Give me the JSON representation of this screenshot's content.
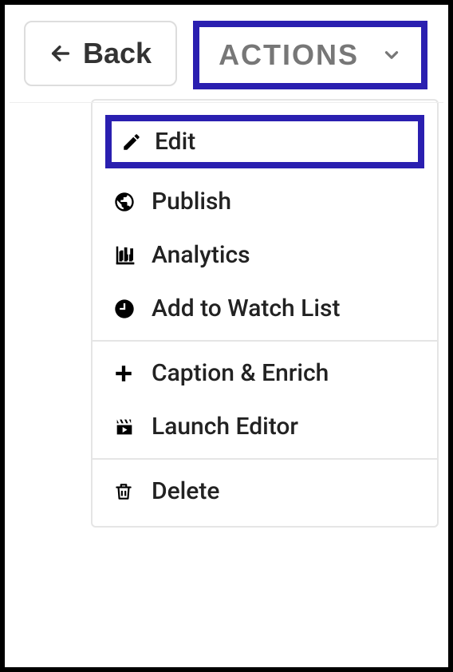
{
  "toolbar": {
    "back_label": "Back",
    "actions_label": "ACTIONS"
  },
  "menu": {
    "sections": [
      {
        "items": [
          {
            "icon": "pencil-icon",
            "label": "Edit",
            "highlighted": true
          },
          {
            "icon": "globe-icon",
            "label": "Publish"
          },
          {
            "icon": "bar-chart-icon",
            "label": "Analytics"
          },
          {
            "icon": "clock-icon",
            "label": "Add to Watch List"
          }
        ]
      },
      {
        "items": [
          {
            "icon": "plus-icon",
            "label": "Caption & Enrich"
          },
          {
            "icon": "clapper-icon",
            "label": "Launch Editor"
          }
        ]
      },
      {
        "items": [
          {
            "icon": "trash-icon",
            "label": "Delete"
          }
        ]
      }
    ]
  }
}
